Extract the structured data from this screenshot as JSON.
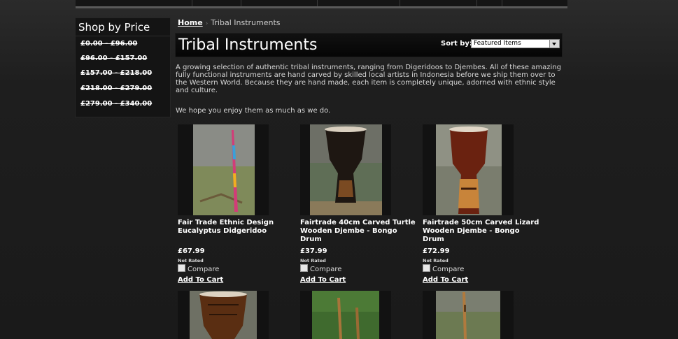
{
  "sidebar": {
    "title": "Shop by Price",
    "price_ranges": [
      "£0.00 - £96.00",
      "£96.00 - £157.00",
      "£157.00 - £218.00",
      "£218.00 - £279.00",
      "£279.00 - £340.00"
    ]
  },
  "breadcrumb": {
    "home": "Home",
    "current": "Tribal Instruments"
  },
  "page": {
    "title": "Tribal Instruments",
    "sort_label": "Sort by:",
    "sort_selected": "Featured Items",
    "description": "A growing selection of authentic tribal instruments, ranging from Digeridoos to Djembes. All of these amazing fully functional instruments are hand carved by skilled local artists in Indonesia before we ship them over to the Western World. Because they are hand made, each item is completely unique, adorned with ethnic style and culture.",
    "description2": "We hope you enjoy them as much as we do."
  },
  "products": [
    {
      "name": "Fair Trade Ethnic Design Eucalyptus Didgeridoo",
      "price": "£67.99",
      "rating": "Not Rated",
      "compare": "Compare",
      "cart": "Add To Cart"
    },
    {
      "name": "Fairtrade 40cm Carved Turtle Wooden Djembe - Bongo Drum",
      "price": "£37.99",
      "rating": "Not Rated",
      "compare": "Compare",
      "cart": "Add To Cart"
    },
    {
      "name": "Fairtrade 50cm Carved Lizard Wooden Djembe - Bongo Drum",
      "price": "£72.99",
      "rating": "Not Rated",
      "compare": "Compare",
      "cart": "Add To Cart"
    }
  ],
  "colors": {
    "background": "#1e1e1e",
    "text": "#ffffff",
    "panel": "#141414"
  }
}
